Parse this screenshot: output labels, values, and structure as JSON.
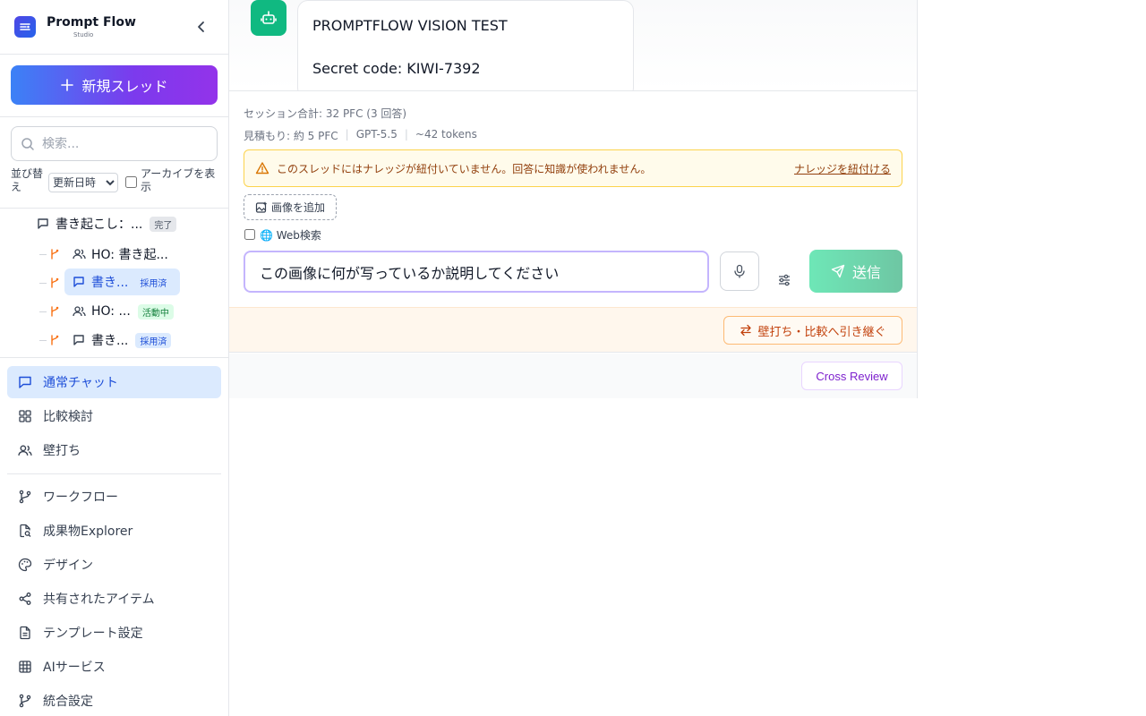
{
  "brand": {
    "name": "Prompt Flow",
    "subtitle": "Studio",
    "logo_icon": "flow-logo-icon",
    "accent": "#4f46e5"
  },
  "sidebar": {
    "new_thread_label": "新規スレッド",
    "search": {
      "placeholder": "検索...",
      "value": ""
    },
    "sort": {
      "label": "並び替え",
      "selected": "更新日時",
      "options": [
        "更新日時"
      ]
    },
    "archive": {
      "label": "アーカイブを表示",
      "checked": false
    },
    "threads": [
      {
        "icon": "chat-bubble-icon",
        "title": "書き起こし：...",
        "badge": "完了",
        "level": 0
      },
      {
        "icon": "users-icon",
        "title": "HO: 書き起...",
        "badge": "",
        "level": 1
      },
      {
        "icon": "chat-bubble-icon",
        "title": "書き...",
        "badge": "採用済",
        "level": 1,
        "selected": true
      },
      {
        "icon": "users-icon",
        "title": "HO: ...",
        "badge": "活動中",
        "level": 1
      },
      {
        "icon": "chat-bubble-icon",
        "title": "書き...",
        "badge": "採用済",
        "level": 1
      }
    ],
    "nav_primary": [
      {
        "label": "通常チャット",
        "icon": "chat-bubble-icon",
        "active": true
      },
      {
        "label": "比較検討",
        "icon": "grid-icon",
        "active": false
      },
      {
        "label": "壁打ち",
        "icon": "users-icon",
        "active": false
      }
    ],
    "nav_secondary": [
      {
        "label": "ワークフロー",
        "icon": "branch-icon"
      },
      {
        "label": "成果物Explorer",
        "icon": "file-search-icon"
      },
      {
        "label": "デザイン",
        "icon": "palette-icon"
      },
      {
        "label": "共有されたアイテム",
        "icon": "share-icon"
      },
      {
        "label": "テンプレート設定",
        "icon": "document-icon"
      },
      {
        "label": "AIサービス",
        "icon": "table-grid-icon"
      },
      {
        "label": "統合設定",
        "icon": "branch-icon"
      }
    ]
  },
  "message": {
    "avatar_icon": "bot-icon",
    "avatar_color": "#10b981",
    "lines": [
      "PROMPTFLOW VISION TEST",
      "Secret code: KIWI-7392"
    ]
  },
  "composer": {
    "session_total": "セッション合計: 32 PFC (3 回答)",
    "estimate": "見積もり: 約 5 PFC",
    "model": "GPT-5.5",
    "tokens": "~42 tokens",
    "warning": "このスレッドにはナレッジが紐付いていません。回答に知識が使われません。",
    "warning_link": "ナレッジを紐付ける",
    "add_image_label": "画像を追加",
    "web_search_label": "🌐 Web検索",
    "web_search_checked": false,
    "input_value": "この画像に何が写っているか説明してください",
    "send_label": "送信"
  },
  "handoff_label": "壁打ち・比較へ引き継ぐ",
  "review_label": "Cross Review"
}
